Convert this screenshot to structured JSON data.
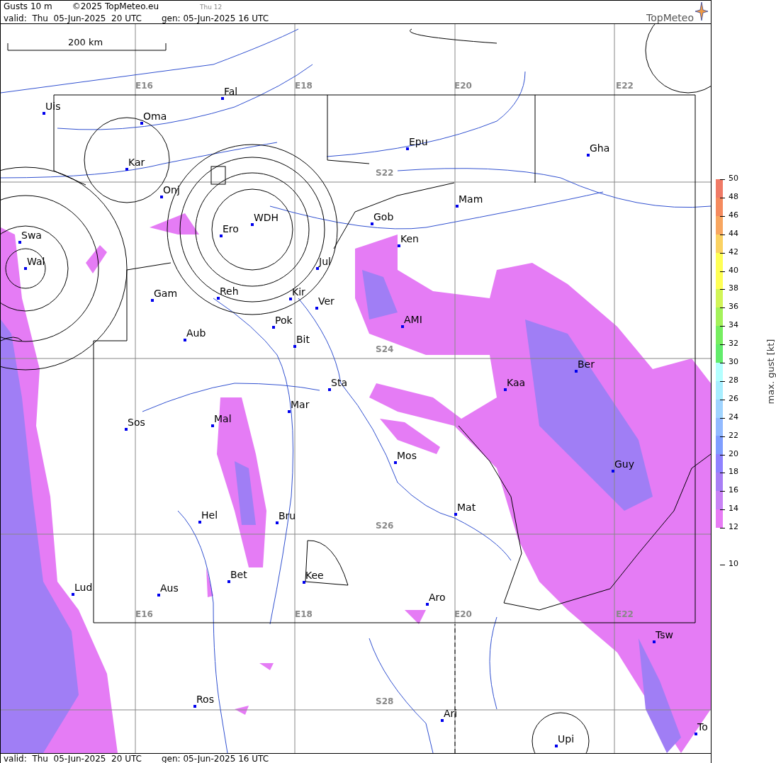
{
  "header": {
    "title": "Gusts 10 m",
    "copyright": "©2025 TopMeteo.eu",
    "day": "Thu 12",
    "valid": "valid:  Thu  05-Jun-2025  20 UTC",
    "generated": "gen: 05-Jun-2025 16 UTC",
    "logo": "TopMeteo"
  },
  "map": {
    "scale": "200 km",
    "grid_labels": [
      {
        "text": "E16"
      },
      {
        "text": "E18"
      },
      {
        "text": "E20"
      },
      {
        "text": "E22"
      },
      {
        "text": "S22"
      },
      {
        "text": "S24"
      },
      {
        "text": "S26"
      },
      {
        "text": "S28"
      },
      {
        "text": "E16"
      },
      {
        "text": "E18"
      },
      {
        "text": "E20"
      },
      {
        "text": "E22"
      }
    ],
    "places": [
      "Uis",
      "Oma",
      "Kar",
      "Fal",
      "Epu",
      "Gha",
      "Onj",
      "Mam",
      "Gob",
      "WDH",
      "Ero",
      "Swa",
      "Ken",
      "Wal",
      "Jul",
      "Gam",
      "Reh",
      "Kir",
      "Ver",
      "Pok",
      "AMI",
      "Aub",
      "Bit",
      "Ber",
      "Sta",
      "Kaa",
      "Mar",
      "Sos",
      "Mal",
      "Mos",
      "Guy",
      "Mat",
      "Hel",
      "Bru",
      "Bet",
      "Kee",
      "Lud",
      "Aus",
      "Aro",
      "Tsw",
      "Ros",
      "Ari",
      "Upi",
      "To"
    ]
  },
  "legend": {
    "title": "max. gust [kt]",
    "ticks": [
      "50",
      "48",
      "46",
      "44",
      "42",
      "40",
      "38",
      "36",
      "34",
      "32",
      "30",
      "28",
      "26",
      "24",
      "22",
      "20",
      "18",
      "16",
      "14",
      "12",
      "10"
    ],
    "bands": [
      {
        "color": "#f07a66"
      },
      {
        "color": "#f58a5e"
      },
      {
        "color": "#f8a660"
      },
      {
        "color": "#fbd262"
      },
      {
        "color": "#ffff55"
      },
      {
        "color": "#ffff55"
      },
      {
        "color": "#d2f557"
      },
      {
        "color": "#a4f25a"
      },
      {
        "color": "#76ee60"
      },
      {
        "color": "#62ec6c"
      },
      {
        "color": "#b4ffff"
      },
      {
        "color": "#a8eeff"
      },
      {
        "color": "#a0d4ff"
      },
      {
        "color": "#92baff"
      },
      {
        "color": "#7f9eff"
      },
      {
        "color": "#8f82ff"
      },
      {
        "color": "#a87ef5"
      },
      {
        "color": "#c982f5"
      },
      {
        "color": "#e87cf5"
      }
    ]
  },
  "footer": {
    "valid": "valid:  Thu  05-Jun-2025  20 UTC",
    "generated": "gen: 05-Jun-2025 16 UTC"
  }
}
